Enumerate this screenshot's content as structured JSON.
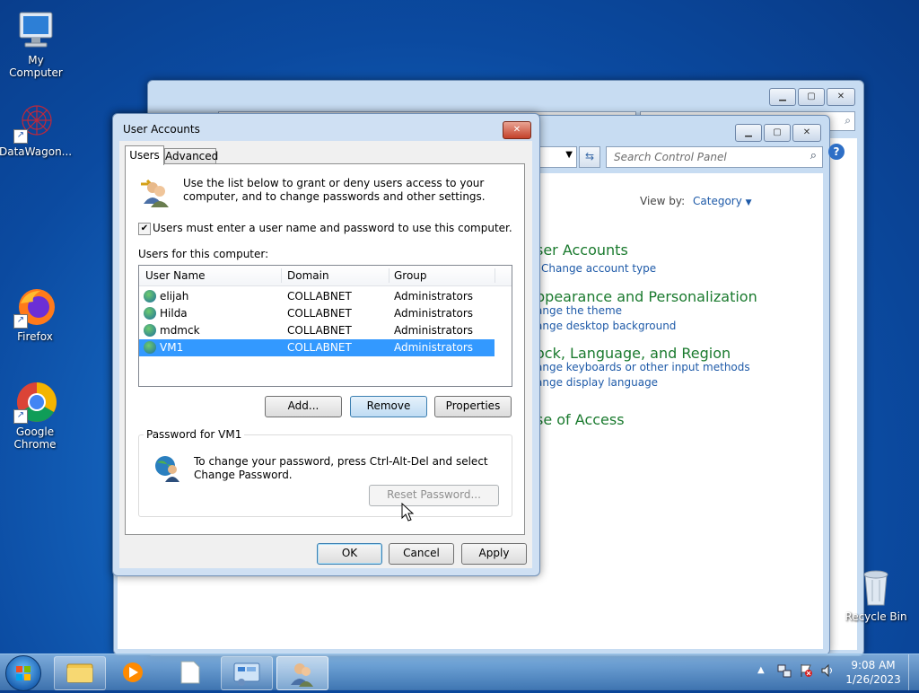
{
  "desktop": {
    "icons": [
      {
        "label": "My Computer",
        "icon": "computer-icon"
      },
      {
        "label": "DataWagon...",
        "icon": "datawagon-icon"
      },
      {
        "label": "Firefox",
        "icon": "firefox-icon"
      },
      {
        "label": "Google Chrome",
        "icon": "chrome-icon"
      },
      {
        "label": "Recycle Bin",
        "icon": "recycle-bin-icon"
      }
    ]
  },
  "control_panel": {
    "search_placeholder": "Search Control Panel",
    "view_by_label": "View by:",
    "view_by_value": "Category",
    "sections": [
      {
        "title": "ser Accounts",
        "links": [
          "Change account type"
        ]
      },
      {
        "title": "ppearance and Personalization",
        "links": [
          "ange the theme",
          "ange desktop background"
        ]
      },
      {
        "title": "ock, Language, and Region",
        "links": [
          "ange keyboards or other input methods",
          "ange display language"
        ]
      },
      {
        "title": "se of Access",
        "links": []
      }
    ]
  },
  "dialog": {
    "title": "User Accounts",
    "tabs": [
      "Users",
      "Advanced"
    ],
    "intro": "Use the list below to grant or deny users access to your computer, and to change passwords and other settings.",
    "checkbox_label": "Users must enter a user name and password to use this computer.",
    "checkbox_checked": true,
    "users_label": "Users for this computer:",
    "columns": [
      "User Name",
      "Domain",
      "Group"
    ],
    "users": [
      {
        "name": "elijah",
        "domain": "COLLABNET",
        "group": "Administrators"
      },
      {
        "name": "Hilda",
        "domain": "COLLABNET",
        "group": "Administrators"
      },
      {
        "name": "mdmck",
        "domain": "COLLABNET",
        "group": "Administrators"
      },
      {
        "name": "VM1",
        "domain": "COLLABNET",
        "group": "Administrators"
      }
    ],
    "selected_user": "VM1",
    "buttons": {
      "add": "Add...",
      "remove": "Remove",
      "properties": "Properties"
    },
    "password_group_title": "Password for VM1",
    "password_text": "To change your password, press Ctrl-Alt-Del and select Change Password.",
    "reset_password": "Reset Password...",
    "footer": {
      "ok": "OK",
      "cancel": "Cancel",
      "apply": "Apply"
    }
  },
  "taskbar": {
    "time": "9:08 AM",
    "date": "1/26/2023",
    "items": [
      "start-orb",
      "explorer-icon",
      "media-player-icon",
      "notepad-icon",
      "control-panel-icon",
      "user-accounts-icon"
    ]
  },
  "colors": {
    "selection": "#3399ff",
    "link": "#1e5aa8",
    "heading": "#1a7a2e",
    "close_button": "#c4412a"
  }
}
